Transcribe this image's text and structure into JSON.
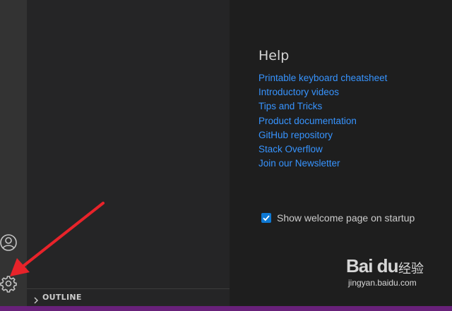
{
  "activity_bar": {
    "icons": [
      "account-icon",
      "gear-icon"
    ]
  },
  "sidebar": {
    "outline_label": "OUTLINE"
  },
  "welcome": {
    "help_title": "Help",
    "help_links": [
      "Printable keyboard cheatsheet",
      "Introductory videos",
      "Tips and Tricks",
      "Product documentation",
      "GitHub repository",
      "Stack Overflow",
      "Join our Newsletter"
    ],
    "startup_checkbox": {
      "label": "Show welcome page on startup",
      "checked": true
    }
  },
  "watermark": {
    "logo": "Bai du",
    "cn": "经验",
    "url": "jingyan.baidu.com"
  },
  "colors": {
    "link": "#3794ff",
    "status_bar": "#68217a",
    "annotation_arrow": "#e8232a"
  }
}
